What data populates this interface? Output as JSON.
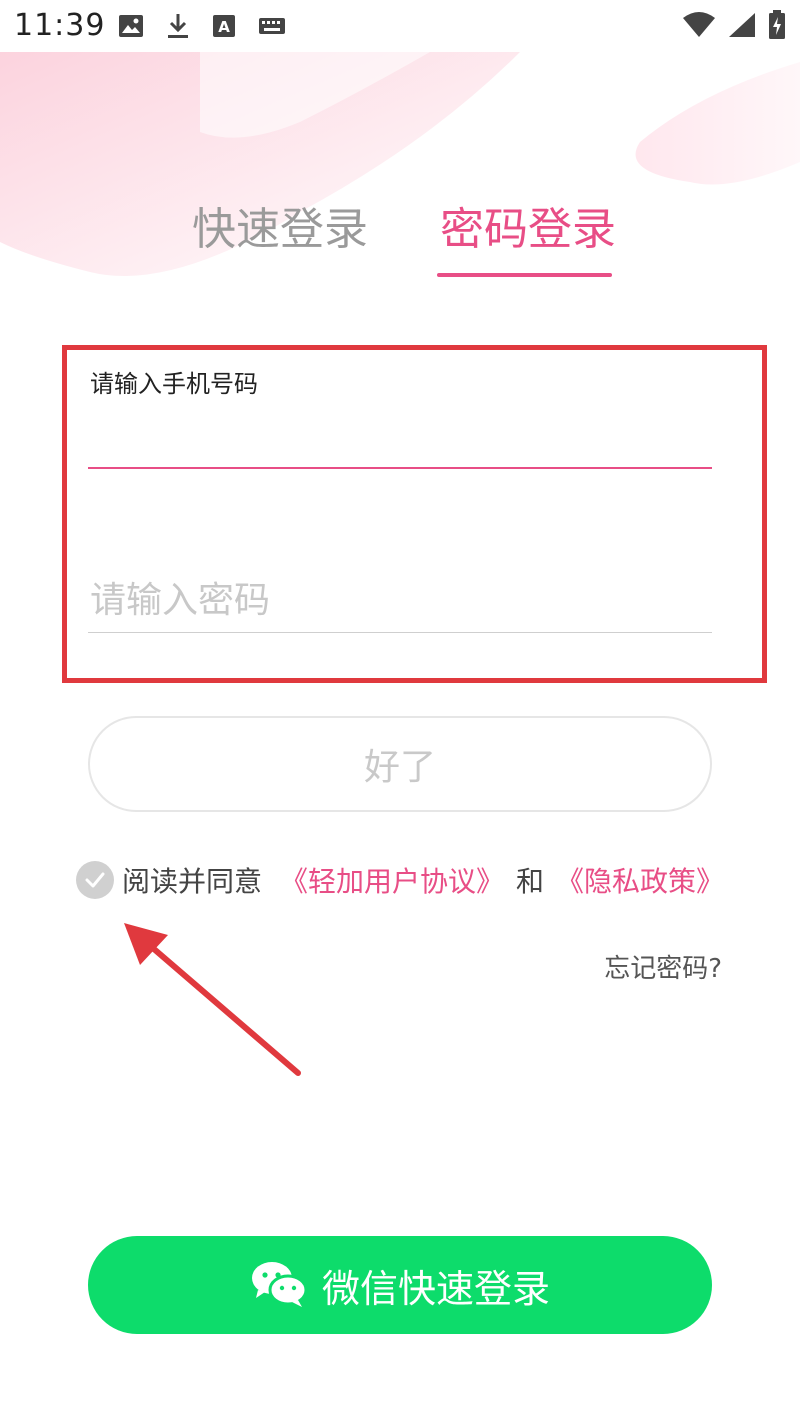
{
  "status_bar": {
    "time": "11:39",
    "left_icons": [
      "image-icon",
      "download-icon",
      "font-icon",
      "keyboard-icon"
    ],
    "right_icons": [
      "wifi-icon",
      "signal-icon",
      "battery-charging-icon"
    ]
  },
  "tabs": [
    {
      "label": "快速登录",
      "active": false
    },
    {
      "label": "密码登录",
      "active": true
    }
  ],
  "form": {
    "phone_label": "请输入手机号码",
    "phone_value": "",
    "password_placeholder": "请输入密码",
    "password_value": ""
  },
  "buttons": {
    "ok_label": "好了",
    "wechat_label": "微信快速登录"
  },
  "agreement": {
    "prefix": "阅读并同意",
    "user_agreement": "《轻加用户协议》",
    "and": "和",
    "privacy_policy": "《隐私政策》",
    "checked": false
  },
  "forgot_password": "忘记密码?",
  "colors": {
    "accent": "#e84e86",
    "annotation_red": "#e0393e",
    "wechat_green": "#0ddc6b",
    "inactive_text": "#9a9a9a"
  }
}
